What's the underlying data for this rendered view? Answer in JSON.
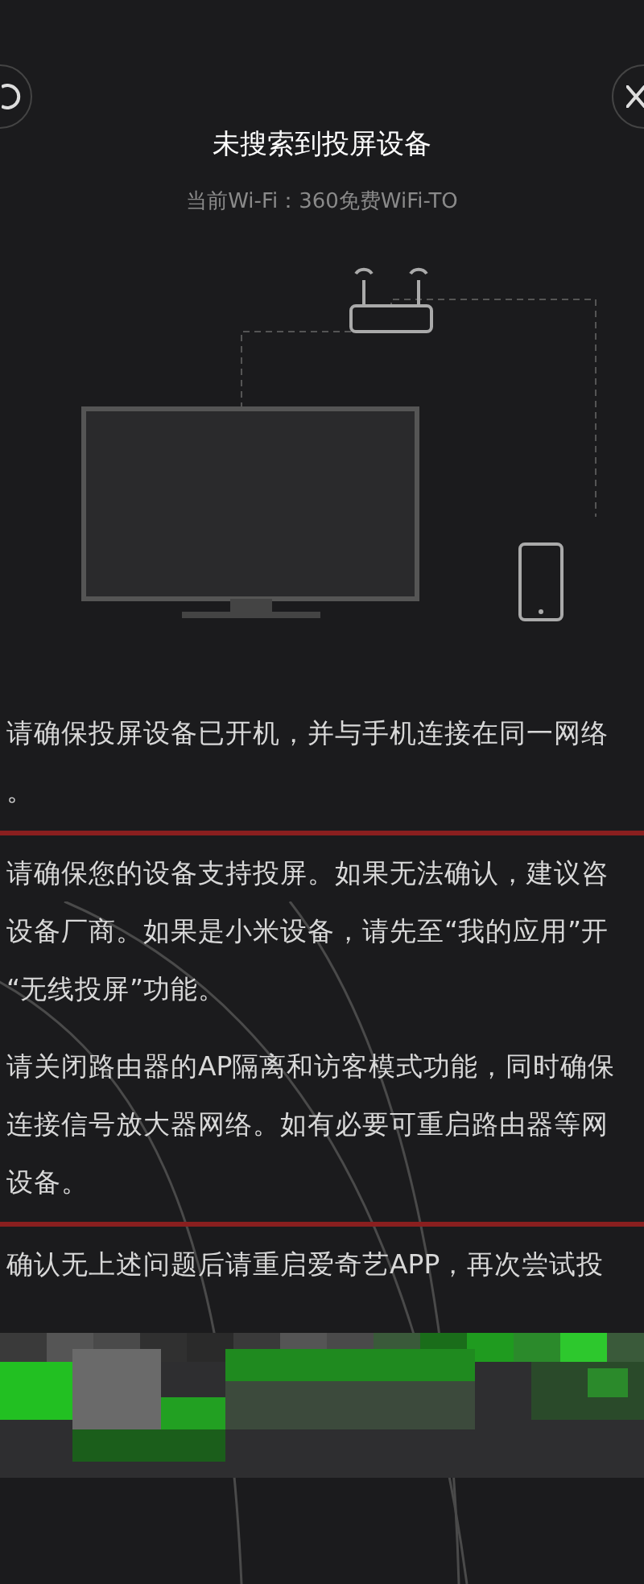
{
  "title": "未搜索到投屏设备",
  "subtitle": "当前Wi-Fi：360免费WiFi-TO",
  "tips": [
    {
      "lines": [
        "请确保投屏设备已开机，并与手机连接在同一网络",
        "。"
      ],
      "marked_below": true
    },
    {
      "lines": [
        "请确保您的设备支持投屏。如果无法确认，建议咨",
        "设备厂商。如果是小米设备，请先至“我的应用”开",
        "“无线投屏”功能。"
      ],
      "marked_below": false
    },
    {
      "lines": [
        "请关闭路由器的AP隔离和访客模式功能，同时确保",
        "连接信号放大器网络。如有必要可重启路由器等网",
        "设备。"
      ],
      "marked_below": true
    },
    {
      "lines": [
        "确认无上述问题后请重启爱奇艺APP，再次尝试投"
      ],
      "marked_below": false
    }
  ]
}
